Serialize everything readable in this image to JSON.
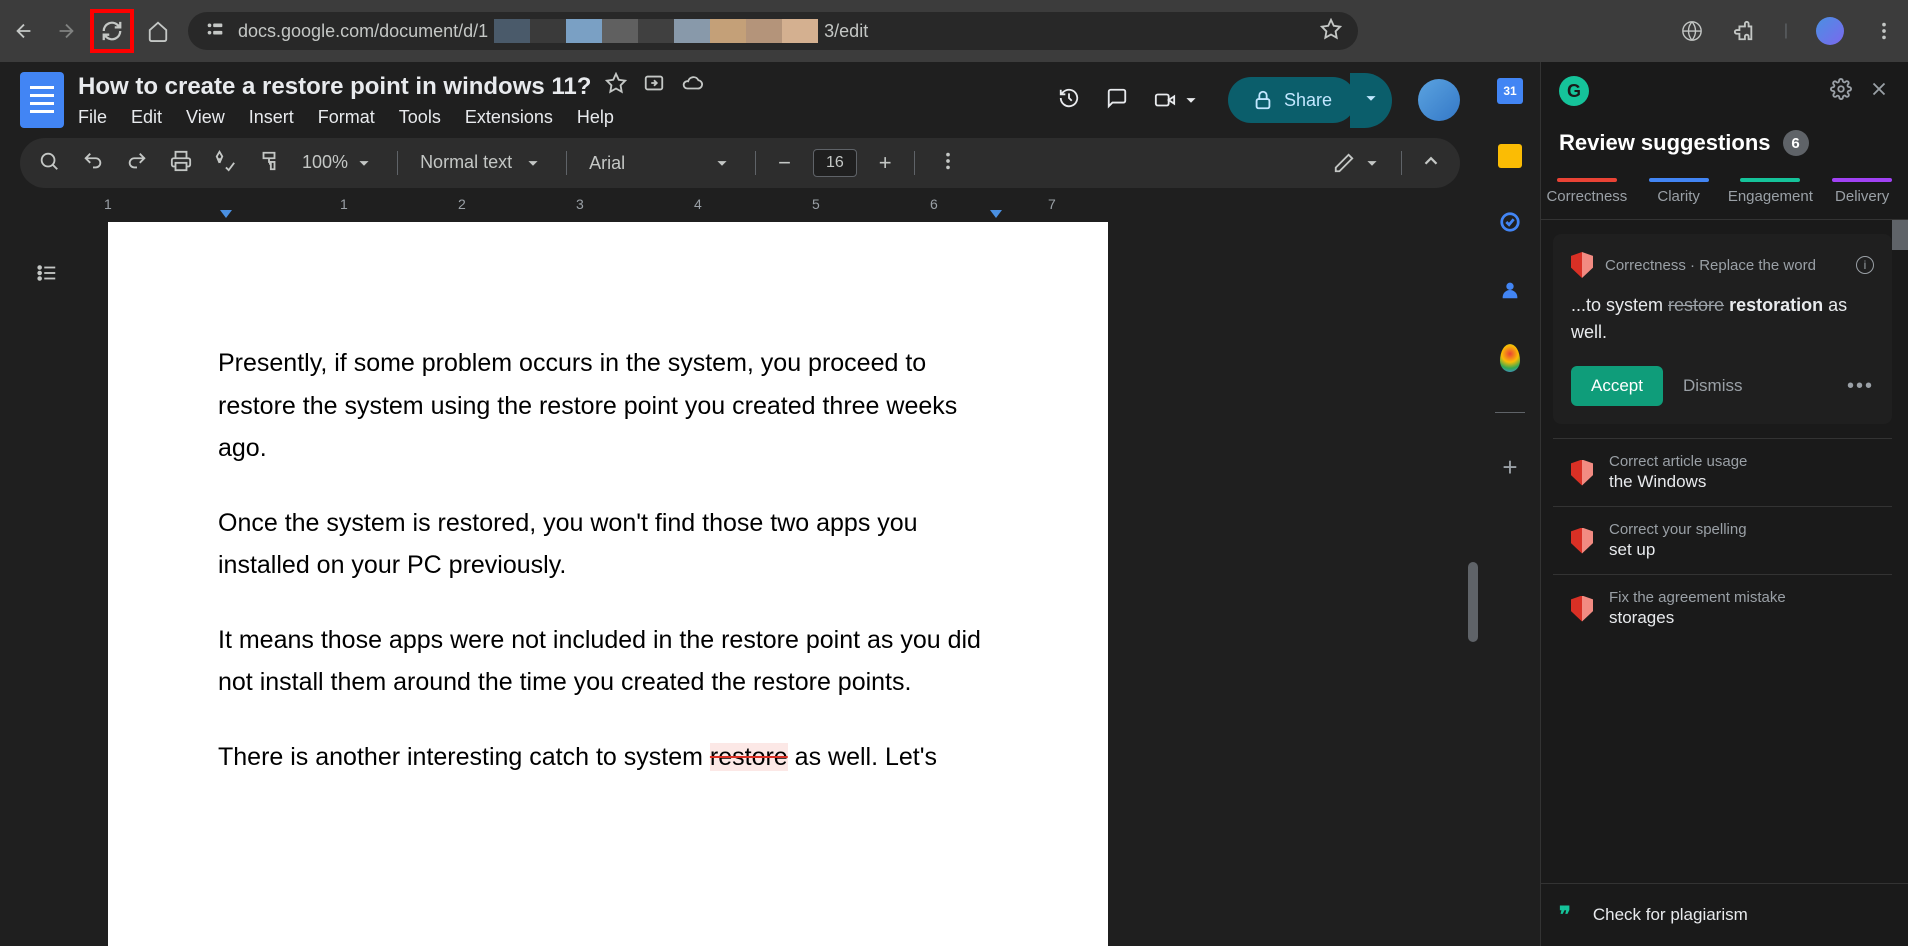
{
  "browser": {
    "url_prefix": "docs.google.com/document/d/1",
    "url_suffix": "3/edit",
    "color_blocks": [
      "#4a5a6a",
      "#3a3a3a",
      "#7aa0c4",
      "#606060",
      "#404040",
      "#8899aa",
      "#c4a078",
      "#b4947a",
      "#d4b090"
    ]
  },
  "doc": {
    "title": "How to create a restore point in windows 11?",
    "menus": [
      "File",
      "Edit",
      "View",
      "Insert",
      "Format",
      "Tools",
      "Extensions",
      "Help"
    ],
    "share_label": "Share"
  },
  "toolbar": {
    "zoom": "100%",
    "style": "Normal text",
    "font": "Arial",
    "size": "16"
  },
  "ruler": [
    "1",
    "1",
    "2",
    "3",
    "4",
    "5",
    "6",
    "7"
  ],
  "content": {
    "p1": "Presently, if some problem occurs in the system, you proceed to restore the system using the restore point you created three weeks ago.",
    "p2": "Once the system is restored, you won't find those two apps you installed on your PC previously.",
    "p3": "It means those apps were not included in the restore point as you did not install them around the time you created the restore points.",
    "p4_a": "There is another interesting catch to system ",
    "p4_mark": "restore",
    "p4_b": " as well. Let's"
  },
  "side": {
    "cal": "31"
  },
  "grammarly": {
    "title": "Review suggestions",
    "count": "6",
    "tabs": [
      {
        "label": "Correctness",
        "color": "#ea4335"
      },
      {
        "label": "Clarity",
        "color": "#4285f4"
      },
      {
        "label": "Engagement",
        "color": "#15c39a"
      },
      {
        "label": "Delivery",
        "color": "#a142f4"
      }
    ],
    "card": {
      "category": "Correctness · Replace the word",
      "prefix": "...to system ",
      "del": "restore",
      "new": "restoration",
      "suffix": " as well.",
      "accept": "Accept",
      "dismiss": "Dismiss"
    },
    "minis": [
      {
        "label": "Correct article usage",
        "value": "the Windows"
      },
      {
        "label": "Correct your spelling",
        "value": "set up"
      },
      {
        "label": "Fix the agreement mistake",
        "value": "storages"
      }
    ],
    "footer": "Check for plagiarism"
  }
}
